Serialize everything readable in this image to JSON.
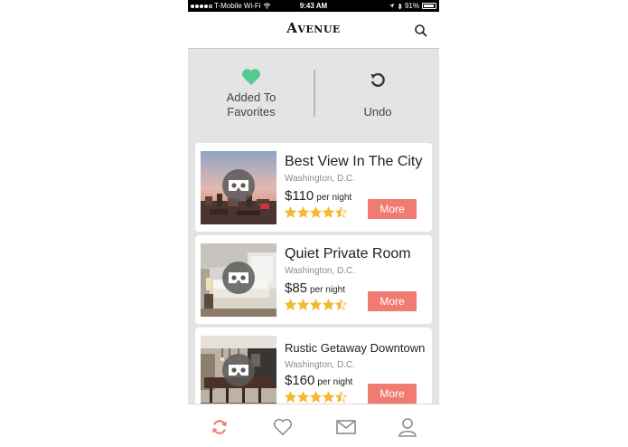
{
  "status_bar": {
    "carrier": "T-Mobile Wi-Fi",
    "time": "9:43 AM",
    "battery": "91%",
    "battery_level": 0.91
  },
  "header": {
    "brand": "Avenue",
    "search_icon": "search-icon"
  },
  "actions": {
    "favorite_label": "Added To Favorites",
    "favorite_icon": "heart-icon",
    "undo_label": "Undo",
    "undo_icon": "undo-icon"
  },
  "colors": {
    "accent": "#ef7b71",
    "heart": "#55c98f",
    "star": "#f5b82e",
    "panel": "#e4e4e4"
  },
  "listings": [
    {
      "title": "Best View In The City",
      "city": "Washington, D.C.",
      "price": "$110",
      "unit": "per night",
      "rating": 4.5,
      "more_label": "More"
    },
    {
      "title": "Quiet Private Room",
      "city": "Washington, D.C.",
      "price": "$85",
      "unit": "per night",
      "rating": 4.5,
      "more_label": "More"
    },
    {
      "title": "Rustic Getaway Downtown",
      "city": "Washington, D.C.",
      "price": "$160",
      "unit": "per night",
      "rating": 4.5,
      "more_label": "More"
    }
  ],
  "tab_bar": {
    "tabs": [
      "refresh-icon",
      "heart-outline-icon",
      "mail-icon",
      "user-icon"
    ],
    "active_tab": "refresh-icon"
  }
}
